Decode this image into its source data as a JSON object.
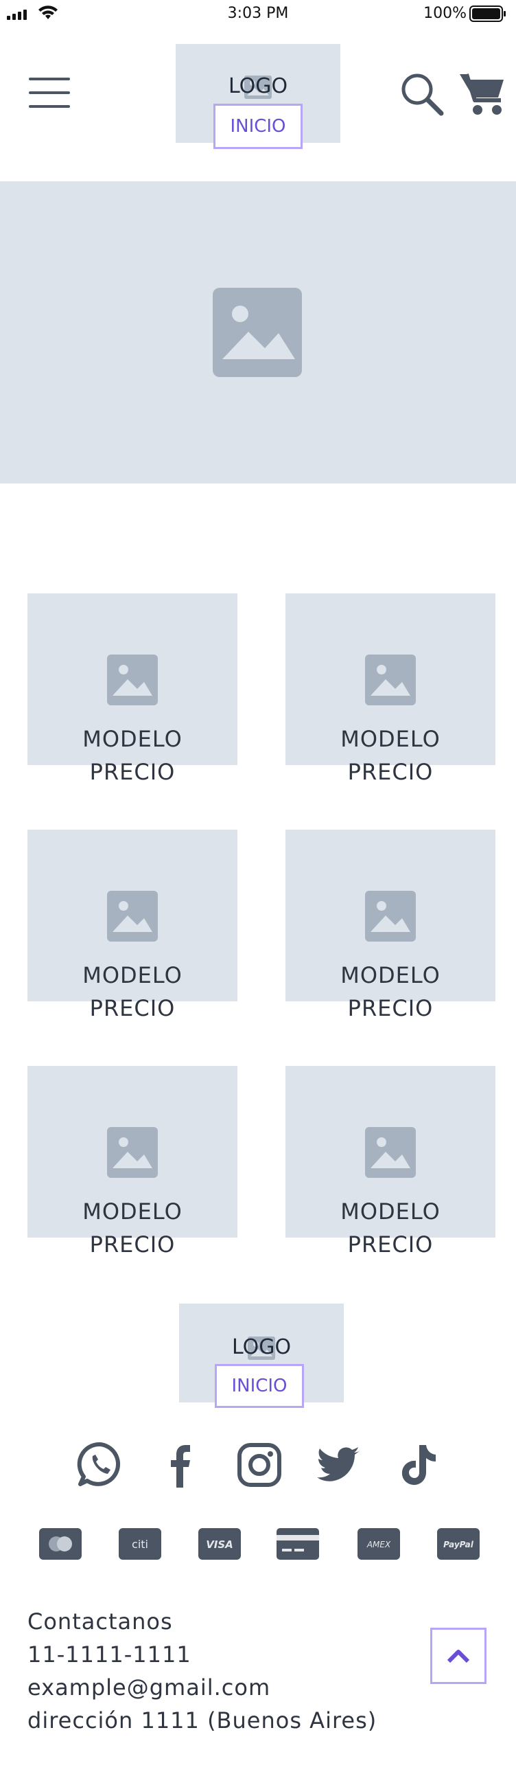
{
  "status_bar": {
    "time": "3:03 PM",
    "battery": "100%"
  },
  "header": {
    "logo": "LOGO",
    "inicio": "INICIO",
    "icons": [
      "menu-icon",
      "search-icon",
      "cart-icon"
    ]
  },
  "hero": {
    "icon": "image-placeholder-icon"
  },
  "products": [
    {
      "modelo": "MODELO",
      "precio": "PRECIO"
    },
    {
      "modelo": "MODELO",
      "precio": "PRECIO"
    },
    {
      "modelo": "MODELO",
      "precio": "PRECIO"
    },
    {
      "modelo": "MODELO",
      "precio": "PRECIO"
    },
    {
      "modelo": "MODELO",
      "precio": "PRECIO"
    },
    {
      "modelo": "MODELO",
      "precio": "PRECIO"
    }
  ],
  "footer": {
    "logo": "LOGO",
    "inicio": "INICIO",
    "social": [
      "whatsapp-icon",
      "facebook-icon",
      "instagram-icon",
      "twitter-icon",
      "tiktok-icon"
    ],
    "payments": [
      "mastercard-icon",
      "citi-icon",
      "visa-icon",
      "credit-card-icon",
      "amex-icon",
      "paypal-icon"
    ],
    "payment_labels": {
      "citi": "citi",
      "visa": "VISA",
      "amex": "AMEX",
      "paypal": "PayPal"
    },
    "contact": {
      "title": "Contactanos",
      "phone": "11-1111-1111",
      "email": "example@gmail.com",
      "address": "dirección 1111 (Buenos Aires)"
    }
  },
  "colors": {
    "placeholder": "#dde3ea",
    "icon": "#4b5563",
    "accent": "#6a4fd6",
    "accent_border": "#b7a6f5"
  }
}
